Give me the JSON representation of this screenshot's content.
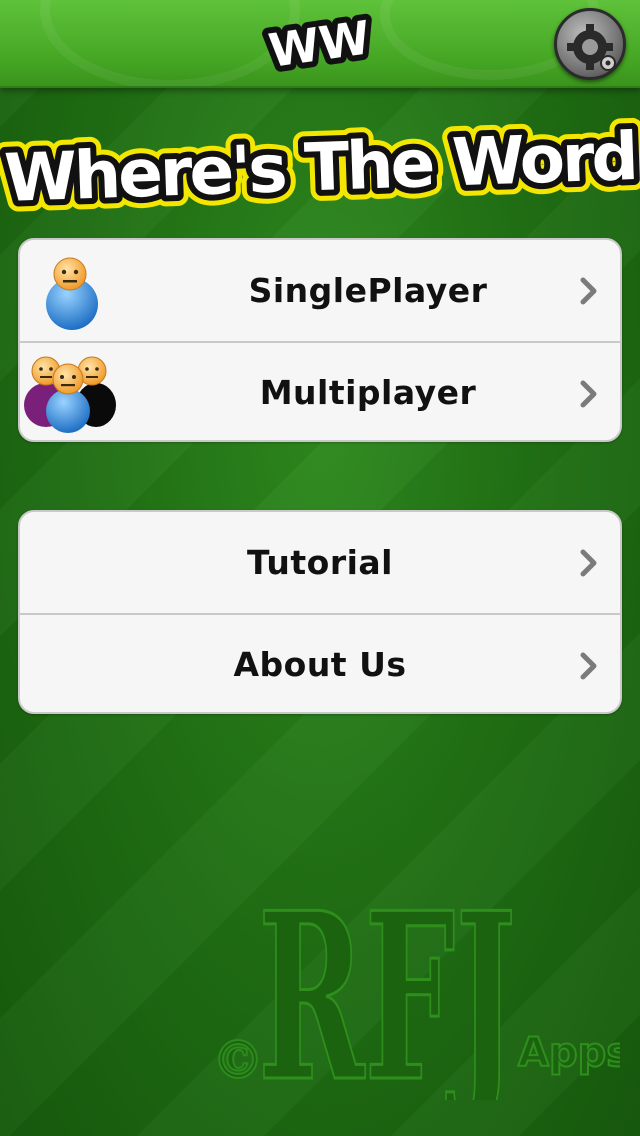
{
  "navbar": {
    "logo_text": "WW",
    "settings_icon": "gear-icon"
  },
  "title": "Where's The Word",
  "menu_group_1": {
    "items": [
      {
        "label": "SinglePlayer",
        "icon": "single-player-icon"
      },
      {
        "label": "Multiplayer",
        "icon": "multiplayer-icon"
      }
    ]
  },
  "menu_group_2": {
    "items": [
      {
        "label": "Tutorial"
      },
      {
        "label": "About Us"
      }
    ]
  },
  "watermark": {
    "copyright": "©",
    "brand": "RFJ",
    "suffix": "Apps"
  },
  "colors": {
    "background": "#1f6d13",
    "navbar": "#45a624",
    "title_fill": "#ffffff",
    "title_outline": "#111111",
    "title_glow": "#f3e600"
  }
}
